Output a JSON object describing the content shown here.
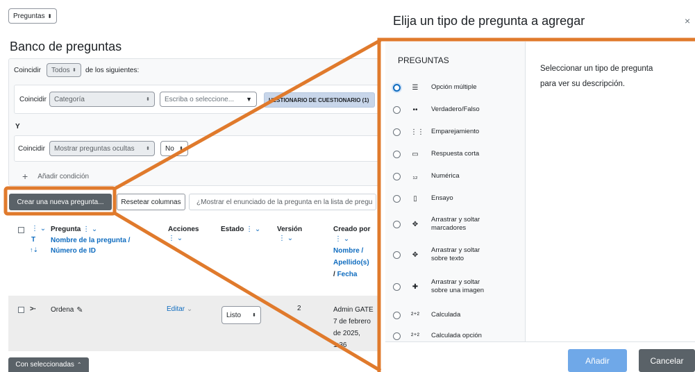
{
  "top_select": "Preguntas",
  "page_title": "Banco de preguntas",
  "filter": {
    "match_label": "Coincidir",
    "match_mode": "Todos",
    "match_suffix": "de los siguientes:",
    "condition1": {
      "label": "Coincidir",
      "field": "Categoría",
      "input_placeholder": "Escriba o seleccione...",
      "pill": "UESTIONARIO DE CUESTIONARIO (1)"
    },
    "and_label": "Y",
    "condition2": {
      "label": "Coincidir",
      "field": "Mostrar preguntas ocultas",
      "value": "No"
    },
    "add_condition": "Añadir condición",
    "add_condition_plus": "+"
  },
  "toolbar": {
    "create_button": "Crear una nueva pregunta...",
    "reset_columns": "Resetear columnas",
    "show_text_button": "¿Mostrar el enunciado de la pregunta en la lista de pregu"
  },
  "table": {
    "headers": {
      "t_marker": "T",
      "t_sort": "↑⇣",
      "pregunta": "Pregunta",
      "nombre": "Nombre de la pregunta /",
      "numero": "Número de ID",
      "acciones": "Acciones",
      "estado": "Estado",
      "version": "Versión",
      "creado_por": "Creado por",
      "nombre2": "Nombre /",
      "apellido": "Apellido(s)",
      "fecha_prefix": "/ ",
      "fecha": "Fecha"
    },
    "row": {
      "type_icon": ">·",
      "name": "Ordena",
      "edit": "Editar",
      "status": "Listo",
      "version": "2",
      "creator_line1": "Admin GATE",
      "creator_line2": "7 de febrero",
      "creator_line3": "de 2025,",
      "creator_line4": "1:36"
    }
  },
  "bulk_button": "Con seleccionadas",
  "modal": {
    "title": "Elija un tipo de pregunta a agregar",
    "close": "×",
    "section_label": "PREGUNTAS",
    "description_line1": "Seleccionar un tipo de pregunta",
    "description_line2": "para ver su descripción.",
    "question_types": [
      {
        "icon": "☰",
        "line1": "Opción múltiple",
        "line2": ""
      },
      {
        "icon": "••",
        "line1": "Verdadero/Falso",
        "line2": ""
      },
      {
        "icon": "⋮⋮",
        "line1": "Emparejamiento",
        "line2": ""
      },
      {
        "icon": "▭",
        "line1": "Respuesta corta",
        "line2": ""
      },
      {
        "icon": "₁₂",
        "line1": "Numérica",
        "line2": ""
      },
      {
        "icon": "▯",
        "line1": "Ensayo",
        "line2": ""
      },
      {
        "icon": "✥",
        "line1": "Arrastrar y soltar",
        "line2": "marcadores"
      },
      {
        "icon": "✥",
        "line1": "Arrastrar y soltar",
        "line2": "sobre texto"
      },
      {
        "icon": "✚",
        "line1": "Arrastrar y soltar",
        "line2": "sobre una imagen"
      },
      {
        "icon": "²⁺²",
        "line1": "Calculada",
        "line2": ""
      },
      {
        "icon": "²⁺²",
        "line1": "Calculada opción",
        "line2": ""
      }
    ],
    "add_button": "Añadir",
    "cancel_button": "Cancelar"
  },
  "colors": {
    "highlight": "#e07a2c",
    "primary": "#0f6cbf",
    "dark_button": "#5a6268",
    "add_button": "#6fa8e8"
  }
}
